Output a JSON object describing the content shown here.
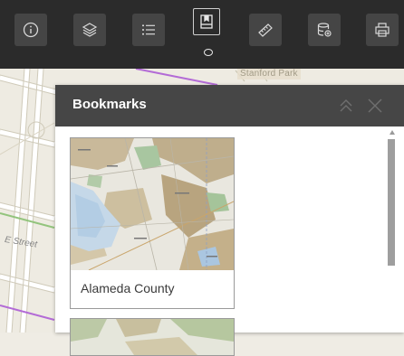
{
  "toolbar": {
    "tools": [
      {
        "icon": "info-icon",
        "active": false
      },
      {
        "icon": "layers-icon",
        "active": false
      },
      {
        "icon": "legend-icon",
        "active": false
      },
      {
        "icon": "bookmark-icon",
        "active": true
      },
      {
        "icon": "measure-icon",
        "active": false
      },
      {
        "icon": "database-icon",
        "active": false
      },
      {
        "icon": "print-icon",
        "active": false
      }
    ]
  },
  "map": {
    "labels": {
      "park": "Stanford Park",
      "street": "E Street"
    }
  },
  "panel": {
    "title": "Bookmarks",
    "bookmarks": [
      {
        "label": "Alameda County"
      }
    ]
  },
  "colors": {
    "toolbar_bg": "#2b2b2b",
    "tool_bg": "#454545",
    "panel_header_bg": "#464646"
  }
}
